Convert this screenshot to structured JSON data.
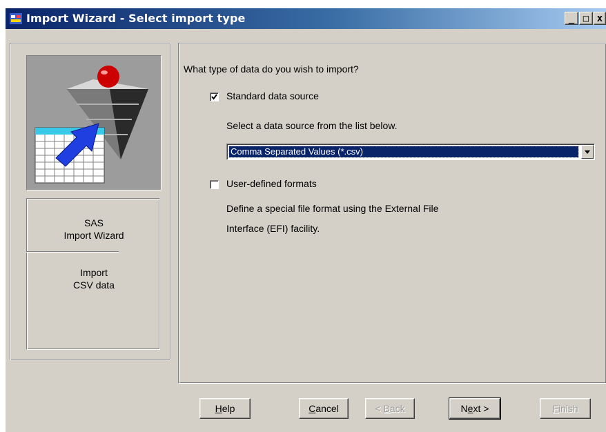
{
  "window": {
    "title": "Import Wizard - Select import type",
    "controls": {
      "minimize": "_",
      "maximize": "□",
      "close": "x"
    }
  },
  "sidebar": {
    "image_icon": "import-wizard-graphic",
    "line1": "SAS",
    "line2": "Import Wizard",
    "line3": "Import",
    "line4": "CSV data"
  },
  "main": {
    "question": "What type of data do you wish to import?",
    "standard": {
      "label": "Standard data source",
      "checked": true
    },
    "select_prompt": "Select a data source from the list below.",
    "source_select": {
      "value": "Comma Separated Values (*.csv)"
    },
    "user_defined": {
      "label": "User-defined formats",
      "checked": false
    },
    "efi_line1": "Define a special file format using the External File",
    "efi_line2": "Interface (EFI) facility."
  },
  "buttons": {
    "help": {
      "pre": "",
      "u": "H",
      "post": "elp"
    },
    "cancel": {
      "pre": "",
      "u": "C",
      "post": "ancel"
    },
    "back": {
      "pre": "< ",
      "u": "B",
      "post": "ack"
    },
    "next": {
      "pre": "N",
      "u": "e",
      "post": "xt >"
    },
    "finish": {
      "pre": "",
      "u": "F",
      "post": "inish"
    }
  },
  "colors": {
    "title_bar": "#0a246a",
    "dialog_face": "#d4d0c8",
    "selection": "#0a246a"
  }
}
